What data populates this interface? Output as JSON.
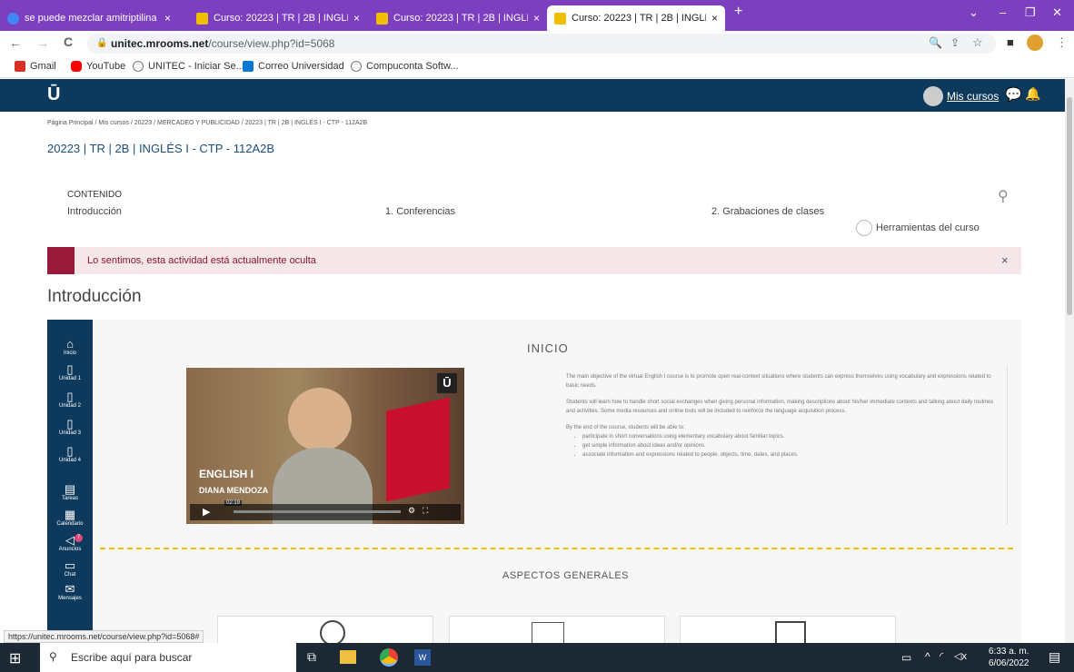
{
  "tabs": [
    {
      "title": "se puede mezclar amitriptilina c",
      "close": "×"
    },
    {
      "title": "Curso: 20223 | TR | 2B | INGLÉS",
      "close": "×"
    },
    {
      "title": "Curso: 20223 | TR | 2B | INGLÉS",
      "close": "×"
    },
    {
      "title": "Curso: 20223 | TR | 2B | INGLÉS",
      "close": "×"
    }
  ],
  "new_tab": "+",
  "address": {
    "domain": "unitec.mrooms.net",
    "path": "/course/view.php?id=5068"
  },
  "bookmarks": [
    "Gmail",
    "YouTube",
    "UNITEC - Iniciar Se...",
    "Correo Universidad",
    "Compuconta Softw..."
  ],
  "site": {
    "logo": "Ū",
    "my_courses": "Mis cursos"
  },
  "breadcrumb": "Página Principal / Mis cursos / 20223 / MERCADEO Y PUBLICIDAD / 20223 | TR | 2B | INGLÉS I - CTP - 112A2B",
  "course_title": "20223 | TR | 2B | INGLÉS I - CTP - 112A2B",
  "section_nav": {
    "heading": "CONTENIDO",
    "items": [
      "Introducción",
      "1. Conferencias",
      "2. Grabaciones de clases"
    ],
    "tools": "Herramientas del curso"
  },
  "alert": {
    "text": "Lo sentimos, esta actividad está actualmente oculta",
    "close": "×"
  },
  "section_title": "Introducción",
  "leftnav": [
    "Inicio",
    "Unidad 1",
    "Unidad 2",
    "Unidad 3",
    "Unidad 4",
    "Tareas",
    "Calendario",
    "Anuncios",
    "Chat",
    "Mensajes"
  ],
  "announce_badge": "7",
  "inicio": {
    "title": "INICIO",
    "p1": "The main objective of the virtual English I course is to promote open real-context situations where students can express themselves using vocabulary and expressions related to basic needs.",
    "p2": "Students will learn how to handle short social exchanges when giving personal information, making descriptions about his/her immediate contexts and talking about daily routines and activities. Some media resources and online tools will be included to reinforce the language acquisition process.",
    "p3": "By the end of the course, students will be able to:",
    "bullets": [
      "participate in short conversations using elementary vocabulary about familiar topics.",
      "get simple information about ideas and/or opinions.",
      "associate information and expressions related to people, objects, time, dates, and places."
    ]
  },
  "video": {
    "title": "ENGLISH I",
    "presenter": "DIANA MENDOZA",
    "time": "02:19",
    "logo": "Ū"
  },
  "aspectos": "ASPECTOS GENERALES",
  "status_url": "https://unitec.mrooms.net/course/view.php?id=5068#",
  "taskbar": {
    "search_placeholder": "Escribe aquí para buscar",
    "time": "6:33 a. m.",
    "date": "6/06/2022"
  }
}
